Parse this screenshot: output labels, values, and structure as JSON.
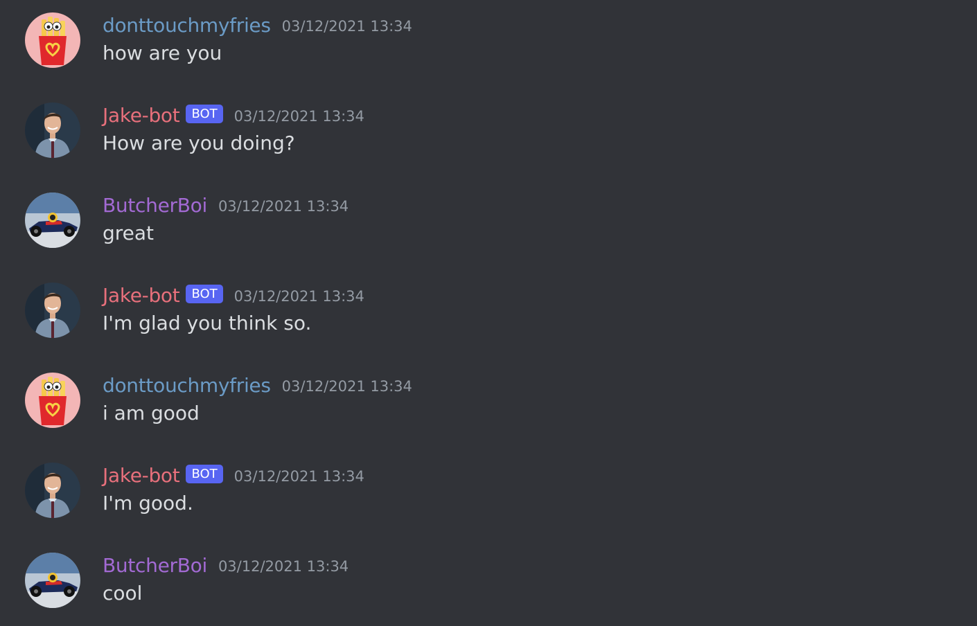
{
  "colors": {
    "background": "#313338",
    "message_text": "#dbdee1",
    "timestamp": "#949ba4",
    "bot_tag_bg": "#5865f2"
  },
  "users": {
    "donttouchmyfries": {
      "name": "donttouchmyfries",
      "color": "#6b9bc6",
      "avatar_icon": "fries-icon",
      "is_bot": false
    },
    "jake": {
      "name": "Jake-bot",
      "color": "#e8707c",
      "avatar_icon": "person-photo-icon",
      "is_bot": true
    },
    "butcher": {
      "name": "ButcherBoi",
      "color": "#a36ad4",
      "avatar_icon": "race-car-icon",
      "is_bot": false
    }
  },
  "bot_tag": "BOT",
  "messages": [
    {
      "author": "donttouchmyfries",
      "bot": false,
      "timestamp": "03/12/2021 13:34",
      "text": "how are you"
    },
    {
      "author": "Jake-bot",
      "bot": true,
      "timestamp": "03/12/2021 13:34",
      "text": "How are you doing?"
    },
    {
      "author": "ButcherBoi",
      "bot": false,
      "timestamp": "03/12/2021 13:34",
      "text": "great"
    },
    {
      "author": "Jake-bot",
      "bot": true,
      "timestamp": "03/12/2021 13:34",
      "text": "I'm glad you think so."
    },
    {
      "author": "donttouchmyfries",
      "bot": false,
      "timestamp": "03/12/2021 13:34",
      "text": "i am good"
    },
    {
      "author": "Jake-bot",
      "bot": true,
      "timestamp": "03/12/2021 13:34",
      "text": "I'm good."
    },
    {
      "author": "ButcherBoi",
      "bot": false,
      "timestamp": "03/12/2021 13:34",
      "text": "cool"
    }
  ]
}
